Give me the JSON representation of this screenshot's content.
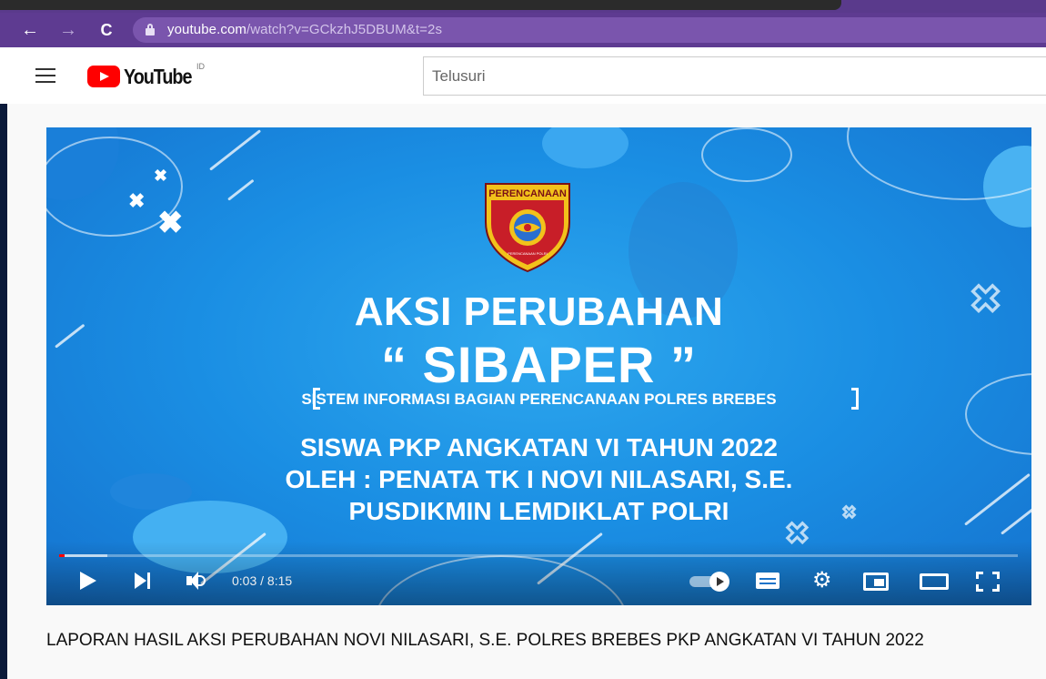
{
  "browser": {
    "url_host": "youtube.com",
    "url_path": "/watch?v=GCkzhJ5DBUM&t=2s",
    "nav": {
      "back": "←",
      "forward": "→",
      "reload": "C"
    }
  },
  "header": {
    "logo_text": "YouTube",
    "country_code": "ID",
    "search_placeholder": "Telusuri"
  },
  "video": {
    "badge_text": "PERENCANAAN",
    "badge_small": "PERENCANAAN POLRI",
    "title_line1": "AKSI PERUBAHAN",
    "title_line2": "“ SIBAPER ”",
    "subtitle": "SISTEM INFORMASI BAGIAN PERENCANAAN POLRES BREBES",
    "line3": "SISWA PKP ANGKATAN VI TAHUN 2022",
    "line4": "OLEH : PENATA TK I NOVI NILASARI, S.E.",
    "line5": "PUSDIKMIN LEMDIKLAT POLRI",
    "player": {
      "current_time": "0:03",
      "duration": "8:15",
      "time_display": "0:03 / 8:15",
      "progress_fraction": 0.006,
      "buffered_fraction": 0.05,
      "gear_glyph": "⚙"
    }
  },
  "video_title": "LAPORAN HASIL AKSI PERUBAHAN NOVI NILASARI, S.E. POLRES BREBES PKP ANGKATAN VI TAHUN 2022",
  "colors": {
    "browser_chrome": "#5e3b91",
    "youtube_red": "#ff0000",
    "video_blue": "#1a8ee3",
    "badge_red": "#d3202a",
    "badge_gold": "#f2c21b"
  }
}
